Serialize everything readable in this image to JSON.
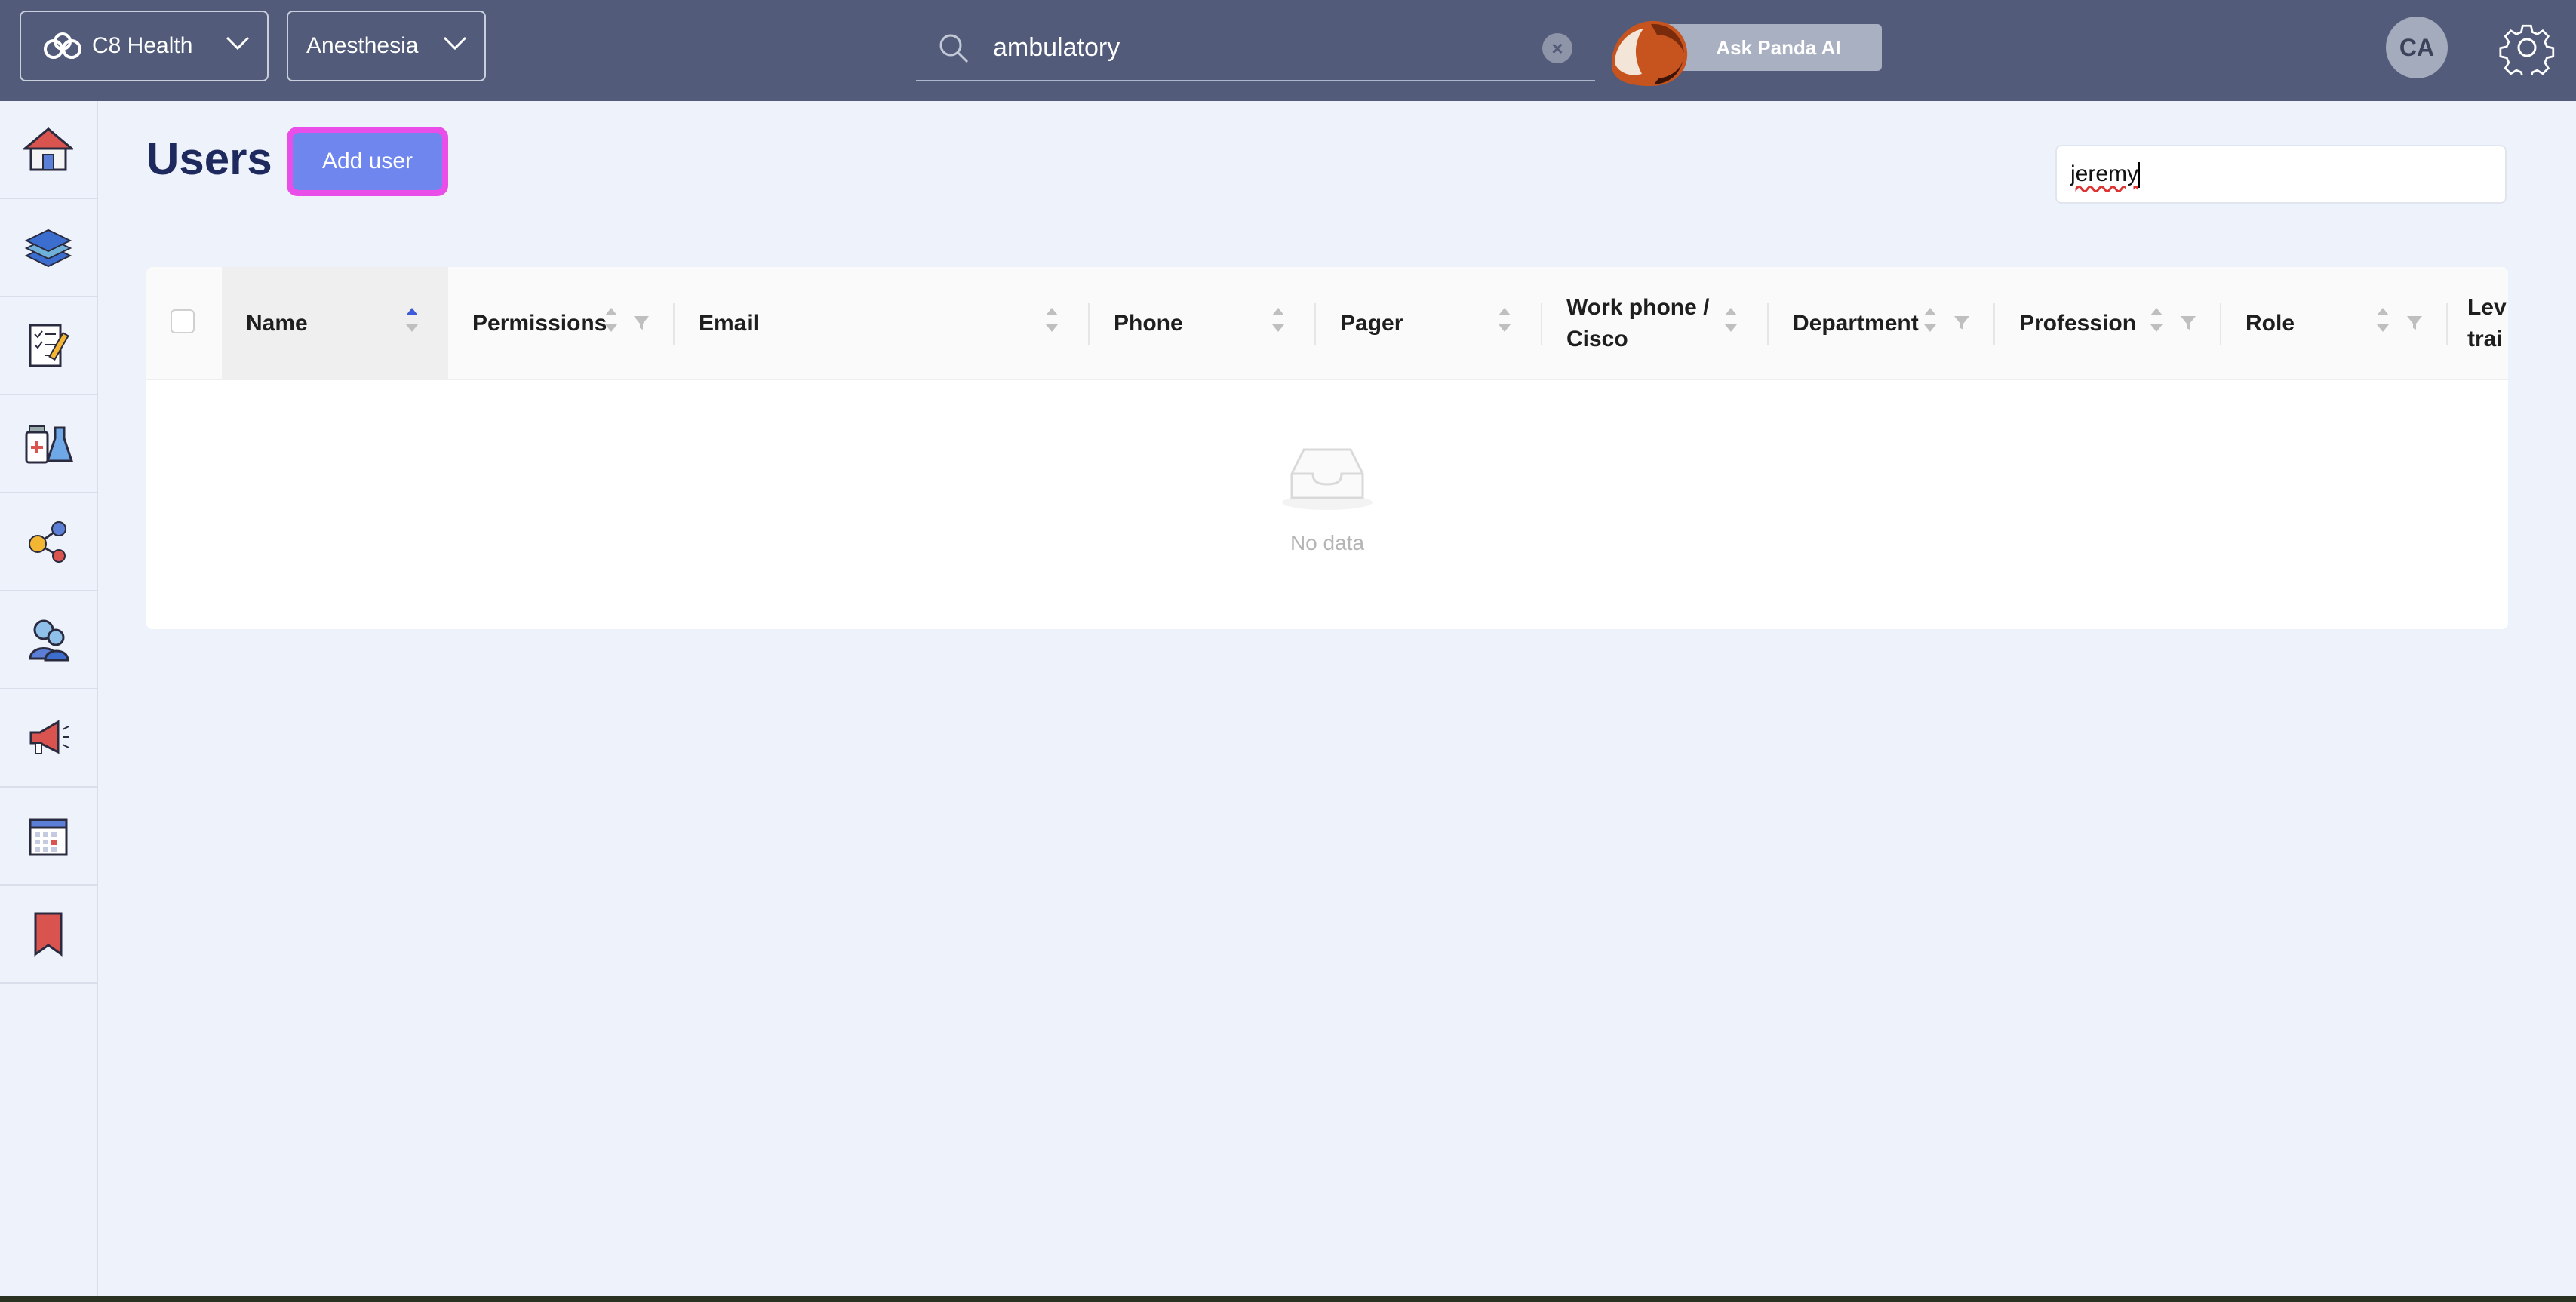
{
  "topbar": {
    "org_label": "C8 Health",
    "dept_label": "Anesthesia",
    "search_value": "ambulatory",
    "clear_symbol": "×",
    "ask_label": "Ask Panda AI",
    "avatar_initials": "CA"
  },
  "sidebar": {
    "items": [
      {
        "icon": "home-icon"
      },
      {
        "icon": "books-icon"
      },
      {
        "icon": "checklist-icon"
      },
      {
        "icon": "lab-icon"
      },
      {
        "icon": "share-network-icon"
      },
      {
        "icon": "users-icon"
      },
      {
        "icon": "megaphone-icon"
      },
      {
        "icon": "calendar-icon"
      },
      {
        "icon": "bookmark-icon"
      }
    ]
  },
  "main": {
    "title": "Users",
    "add_user_label": "Add user",
    "filter_value": "jeremy",
    "table": {
      "columns": [
        "Name",
        "Permissions",
        "Email",
        "Phone",
        "Pager",
        "Work phone /",
        "Cisco",
        "Department",
        "Profession",
        "Role",
        "Lev",
        "trai"
      ],
      "empty_text": "No data"
    }
  },
  "colors": {
    "topbar": "#525c7a",
    "accent_button": "#6e86ee",
    "highlight": "#e94ee9",
    "title": "#1e2a5e"
  }
}
